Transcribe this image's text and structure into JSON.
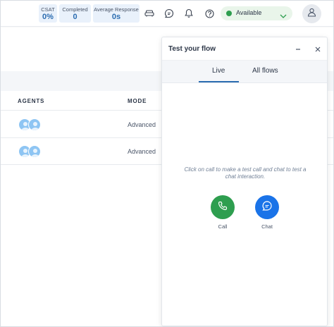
{
  "metrics": [
    {
      "label": "CSAT",
      "value": "0%"
    },
    {
      "label": "Completed",
      "value": "0"
    },
    {
      "label": "Average Response",
      "value": "0s"
    }
  ],
  "topbar_icons": [
    "sofa-icon",
    "chat-bubble-icon",
    "bell-icon",
    "help-circle-icon"
  ],
  "status": {
    "label": "Available",
    "color": "#2e9e4f"
  },
  "table": {
    "headers": {
      "agents": "AGENTS",
      "mode": "MODE"
    },
    "rows": [
      {
        "mode": "Advanced"
      },
      {
        "mode": "Advanced"
      }
    ]
  },
  "test_panel": {
    "title": "Test your flow",
    "tabs": {
      "live": "Live",
      "all_flows": "All flows"
    },
    "active_tab": "Live",
    "hint": "Click on call to make a test call and chat to test a chat interaction.",
    "call_label": "Call",
    "chat_label": "Chat"
  },
  "colors": {
    "accent": "#2b6cb0",
    "call": "#2e9e4f",
    "chat": "#1a73e8",
    "metric_bg": "#e9f1fb"
  }
}
